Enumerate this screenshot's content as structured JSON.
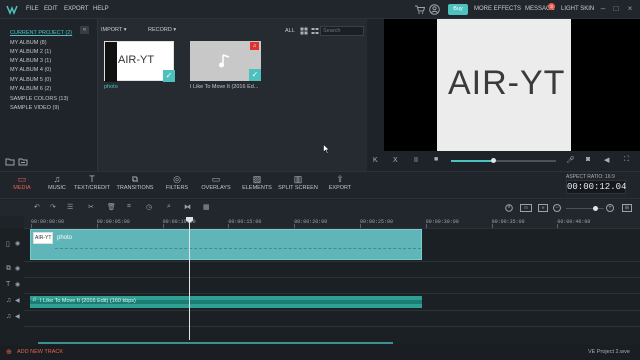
{
  "menu": {
    "file": "FILE",
    "edit": "EDIT",
    "export": "EXPORT",
    "help": "HELP"
  },
  "topright": {
    "buy": "Buy",
    "more_effects": "MORE EFFECTS",
    "message": "MESSAGE",
    "message_badge": "3",
    "light_skin": "LIGHT SKIN"
  },
  "library": {
    "albums": [
      "CURRENT PROJECT (2)",
      "MY ALBUM (8)",
      "MY ALBUM 2 (1)",
      "MY ALBUM 3 (1)",
      "MY ALBUM 4 (0)",
      "MY ALBUM 5 (0)",
      "MY ALBUM 6 (2)",
      "SAMPLE COLORS (13)",
      "SAMPLE VIDEO (9)"
    ],
    "import": "IMPORT",
    "record": "RECORD",
    "filter_all": "ALL",
    "search_placeholder": "Search",
    "media": [
      {
        "name": "photo",
        "thumb_text": "AIR-YT"
      },
      {
        "name": "I Like To Move It (2016 Ed..."
      }
    ]
  },
  "preview": {
    "text": "AIR-YT"
  },
  "tools": [
    {
      "icon": "media-icon",
      "label": "MEDIA"
    },
    {
      "icon": "music-icon",
      "label": "MUSIC"
    },
    {
      "icon": "text-icon",
      "label": "TEXT/CREDIT"
    },
    {
      "icon": "transitions-icon",
      "label": "TRANSITIONS"
    },
    {
      "icon": "filters-icon",
      "label": "FILTERS"
    },
    {
      "icon": "overlays-icon",
      "label": "OVERLAYS"
    },
    {
      "icon": "elements-icon",
      "label": "ELEMENTS"
    },
    {
      "icon": "splitscreen-icon",
      "label": "SPLIT SCREEN"
    },
    {
      "icon": "export-icon",
      "label": "EXPORT"
    }
  ],
  "aspect": {
    "label": "ASPECT RATIO: 16:9",
    "time": "00:00:12.04"
  },
  "ruler": [
    "00:00:00:00",
    "00:00:05:00",
    "00:00:10:00",
    "00:00:15:00",
    "00:00:20:00",
    "00:00:25:00",
    "00:00:30:00",
    "00:00:35:00",
    "00:00:40:00"
  ],
  "timeline": {
    "video_clip": "photo",
    "video_thumb": "AIR-YT",
    "audio_clip": "I Like To Move It (2016 Edit) (160 kbps)"
  },
  "bottom": {
    "add_track": "ADD NEW TRACK",
    "project": "VE Project 2.wve"
  },
  "colors": {
    "accent": "#4dc1bd",
    "tool_active": "#e8614c",
    "clip": "#5fb5b8",
    "audio": "#2e9f93"
  }
}
